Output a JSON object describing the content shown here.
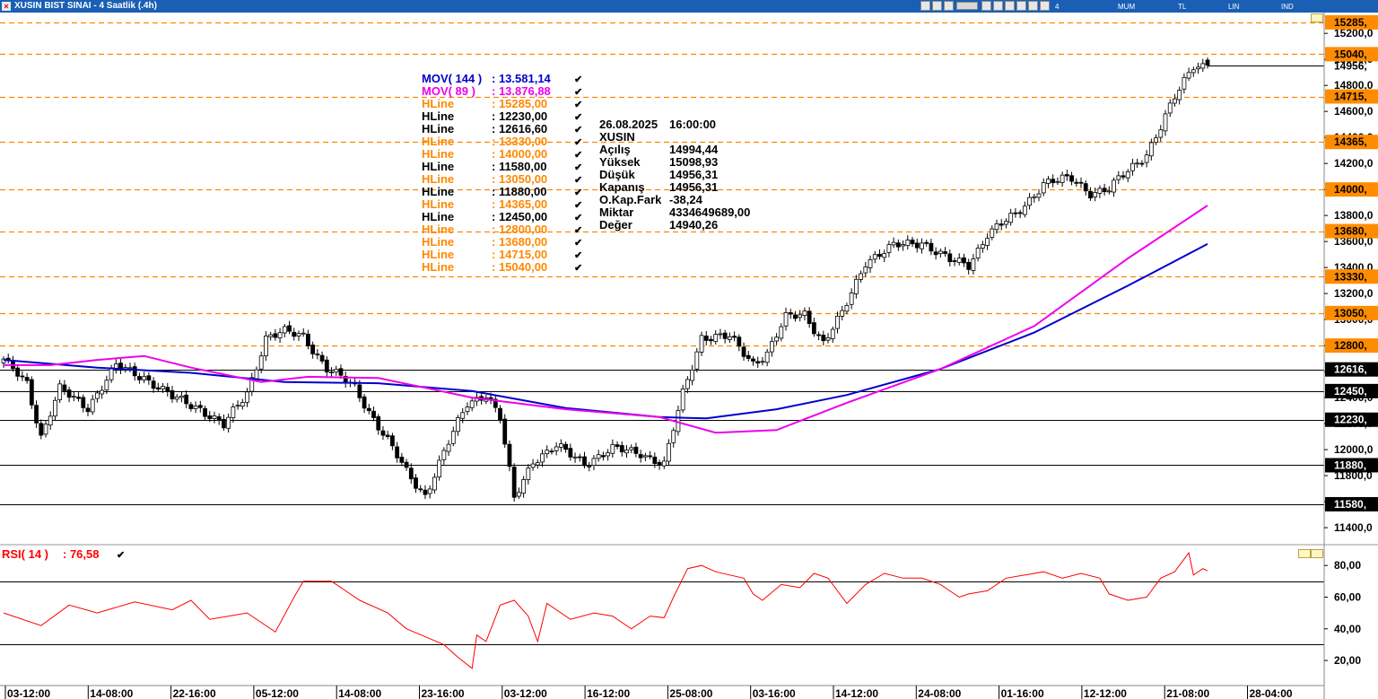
{
  "window": {
    "title": "XUSIN BIST SINAI - 4 Saatlik (.4h)",
    "toolbar_labels": [
      "4 Saatlik",
      "MUM",
      "TL",
      "LIN",
      "IND"
    ],
    "close_glyph": "×"
  },
  "colors": {
    "mov144": "#0000cc",
    "mov89": "#ee00ee",
    "hline_orange": "#ff8800",
    "hline_black": "#000000",
    "rsi": "#ff0000",
    "price_tag_bg": "#ff8c00"
  },
  "legend": [
    {
      "name": "MOV( 144 )",
      "value": ": 13.581,14",
      "color": "#0000cc"
    },
    {
      "name": "MOV( 89 )",
      "value": ": 13.876,88",
      "color": "#ee00ee"
    },
    {
      "name": "HLine",
      "value": ": 15285,00",
      "color": "#ff8800"
    },
    {
      "name": "HLine",
      "value": ": 12230,00",
      "color": "#000000"
    },
    {
      "name": "HLine",
      "value": ": 12616,60",
      "color": "#000000"
    },
    {
      "name": "HLine",
      "value": ": 13330,00",
      "color": "#ff8800"
    },
    {
      "name": "HLine",
      "value": ": 14000,00",
      "color": "#ff8800"
    },
    {
      "name": "HLine",
      "value": ": 11580,00",
      "color": "#000000"
    },
    {
      "name": "HLine",
      "value": ": 13050,00",
      "color": "#ff8800"
    },
    {
      "name": "HLine",
      "value": ": 11880,00",
      "color": "#000000"
    },
    {
      "name": "HLine",
      "value": ": 14365,00",
      "color": "#ff8800"
    },
    {
      "name": "HLine",
      "value": ": 12450,00",
      "color": "#000000"
    },
    {
      "name": "HLine",
      "value": ": 12800,00",
      "color": "#ff8800"
    },
    {
      "name": "HLine",
      "value": ": 13680,00",
      "color": "#ff8800"
    },
    {
      "name": "HLine",
      "value": ": 14715,00",
      "color": "#ff8800"
    },
    {
      "name": "HLine",
      "value": ": 15040,00",
      "color": "#ff8800"
    }
  ],
  "info_box": {
    "date": "26.08.2025",
    "time": "16:00:00",
    "symbol": "XUSIN",
    "rows": [
      {
        "label": "Açılış",
        "value": "14994,44"
      },
      {
        "label": "Yüksek",
        "value": "15098,93"
      },
      {
        "label": "Düşük",
        "value": "14956,31"
      },
      {
        "label": "Kapanış",
        "value": "14956,31"
      },
      {
        "label": "O.Kap.Fark",
        "value": "-38,24"
      },
      {
        "label": "Miktar",
        "value": "4334649689,00"
      },
      {
        "label": "Değer",
        "value": "14940,26"
      }
    ]
  },
  "rsi_label": {
    "name": "RSI( 14 )",
    "value": ": 76,58"
  },
  "check_glyph": "✔",
  "chart_data": [
    {
      "type": "candlestick",
      "title": "XUSIN BIST SINAI - 4 Saatlik (.4h)",
      "ylim": [
        11290,
        15360
      ],
      "y_ticks": [
        {
          "value": 11400,
          "label": "11400,0"
        },
        {
          "value": 11600,
          "label": "11600,0"
        },
        {
          "value": 11800,
          "label": "11800,0"
        },
        {
          "value": 12000,
          "label": "12000,0"
        },
        {
          "value": 12200,
          "label": "12200,0"
        },
        {
          "value": 12400,
          "label": "12400,0"
        },
        {
          "value": 12600,
          "label": "12600,0"
        },
        {
          "value": 12800,
          "label": "12800,0"
        },
        {
          "value": 13000,
          "label": "13000,0"
        },
        {
          "value": 13200,
          "label": "13200,0"
        },
        {
          "value": 13400,
          "label": "13400,0"
        },
        {
          "value": 13600,
          "label": "13600,0"
        },
        {
          "value": 13800,
          "label": "13800,0"
        },
        {
          "value": 14000,
          "label": "14000,0"
        },
        {
          "value": 14200,
          "label": "14200,0"
        },
        {
          "value": 14400,
          "label": "14400,0"
        },
        {
          "value": 14600,
          "label": "14600,0"
        },
        {
          "value": 14800,
          "label": "14800,0"
        },
        {
          "value": 15000,
          "label": "15000,0"
        },
        {
          "value": 15200,
          "label": "15200,0"
        }
      ],
      "x_tick_labels": [
        "03-12:00",
        "14-08:00",
        "22-16:00",
        "05-12:00",
        "14-08:00",
        "23-16:00",
        "03-12:00",
        "16-12:00",
        "25-08:00",
        "03-16:00",
        "14-12:00",
        "24-08:00",
        "01-16:00",
        "12-12:00",
        "21-08:00",
        "28-04:00"
      ],
      "hlines": [
        {
          "value": 15285,
          "label": "15285,",
          "color": "#ff8800",
          "style": "dashed"
        },
        {
          "value": 15040,
          "label": "15040,",
          "color": "#ff8800",
          "style": "dashed"
        },
        {
          "value": 14715,
          "label": "14715,",
          "color": "#ff8800",
          "style": "dashed"
        },
        {
          "value": 14365,
          "label": "14365,",
          "color": "#ff8800",
          "style": "dashed"
        },
        {
          "value": 14000,
          "label": "14000,",
          "color": "#ff8800",
          "style": "dashed"
        },
        {
          "value": 13680,
          "label": "13680,",
          "color": "#ff8800",
          "style": "dashed"
        },
        {
          "value": 13330,
          "label": "13330,",
          "color": "#ff8800",
          "style": "dashed"
        },
        {
          "value": 13050,
          "label": "13050,",
          "color": "#ff8800",
          "style": "dashed"
        },
        {
          "value": 12800,
          "label": "12800,",
          "color": "#ff8800",
          "style": "dashed"
        },
        {
          "value": 12616.6,
          "label": "12616,",
          "color": "#000000",
          "style": "solid"
        },
        {
          "value": 12450,
          "label": "12450,",
          "color": "#000000",
          "style": "solid"
        },
        {
          "value": 12230,
          "label": "12230,",
          "color": "#000000",
          "style": "solid"
        },
        {
          "value": 11880,
          "label": "11880,",
          "color": "#000000",
          "style": "solid"
        },
        {
          "value": 11580,
          "label": "11580,",
          "color": "#000000",
          "style": "solid"
        }
      ],
      "last_price": {
        "value": 14956.31,
        "label": "14956,"
      },
      "close_anchors": [
        {
          "i": 0,
          "close": 12680
        },
        {
          "i": 5,
          "close": 12520
        },
        {
          "i": 8,
          "close": 12100
        },
        {
          "i": 12,
          "close": 12460
        },
        {
          "i": 18,
          "close": 12330
        },
        {
          "i": 24,
          "close": 12640
        },
        {
          "i": 30,
          "close": 12560
        },
        {
          "i": 36,
          "close": 12400
        },
        {
          "i": 42,
          "close": 12320
        },
        {
          "i": 47,
          "close": 12180
        },
        {
          "i": 52,
          "close": 12440
        },
        {
          "i": 56,
          "close": 12860
        },
        {
          "i": 60,
          "close": 12900
        },
        {
          "i": 64,
          "close": 12880
        },
        {
          "i": 69,
          "close": 12620
        },
        {
          "i": 75,
          "close": 12480
        },
        {
          "i": 80,
          "close": 12180
        },
        {
          "i": 86,
          "close": 11830
        },
        {
          "i": 90,
          "close": 11650
        },
        {
          "i": 95,
          "close": 12050
        },
        {
          "i": 99,
          "close": 12360
        },
        {
          "i": 103,
          "close": 12430
        },
        {
          "i": 106,
          "close": 12240
        },
        {
          "i": 109,
          "close": 11620
        },
        {
          "i": 113,
          "close": 11920
        },
        {
          "i": 118,
          "close": 12020
        },
        {
          "i": 124,
          "close": 11900
        },
        {
          "i": 130,
          "close": 12000
        },
        {
          "i": 136,
          "close": 11980
        },
        {
          "i": 141,
          "close": 11880
        },
        {
          "i": 145,
          "close": 12430
        },
        {
          "i": 149,
          "close": 12870
        },
        {
          "i": 155,
          "close": 12860
        },
        {
          "i": 160,
          "close": 12670
        },
        {
          "i": 163,
          "close": 12740
        },
        {
          "i": 167,
          "close": 13010
        },
        {
          "i": 171,
          "close": 13050
        },
        {
          "i": 175,
          "close": 12820
        },
        {
          "i": 179,
          "close": 13040
        },
        {
          "i": 184,
          "close": 13450
        },
        {
          "i": 190,
          "close": 13560
        },
        {
          "i": 196,
          "close": 13600
        },
        {
          "i": 202,
          "close": 13450
        },
        {
          "i": 206,
          "close": 13420
        },
        {
          "i": 210,
          "close": 13660
        },
        {
          "i": 216,
          "close": 13800
        },
        {
          "i": 222,
          "close": 14050
        },
        {
          "i": 228,
          "close": 14080
        },
        {
          "i": 232,
          "close": 13980
        },
        {
          "i": 236,
          "close": 14000
        },
        {
          "i": 240,
          "close": 14140
        },
        {
          "i": 244,
          "close": 14280
        },
        {
          "i": 247,
          "close": 14480
        },
        {
          "i": 250,
          "close": 14700
        },
        {
          "i": 254,
          "close": 14960
        },
        {
          "i": 257,
          "close": 14956
        }
      ],
      "series": [
        {
          "name": "MOV( 144 )",
          "color": "#0000cc",
          "last_value": 13581.14,
          "points": [
            [
              0,
              12690
            ],
            [
              20,
              12630
            ],
            [
              40,
              12590
            ],
            [
              60,
              12520
            ],
            [
              80,
              12510
            ],
            [
              100,
              12450
            ],
            [
              120,
              12320
            ],
            [
              140,
              12250
            ],
            [
              150,
              12240
            ],
            [
              165,
              12310
            ],
            [
              180,
              12420
            ],
            [
              200,
              12620
            ],
            [
              220,
              12900
            ],
            [
              240,
              13260
            ],
            [
              257,
              13581.14
            ]
          ]
        },
        {
          "name": "MOV( 89 )",
          "color": "#ee00ee",
          "last_value": 13876.88,
          "points": [
            [
              0,
              12650
            ],
            [
              10,
              12650
            ],
            [
              20,
              12690
            ],
            [
              30,
              12720
            ],
            [
              40,
              12630
            ],
            [
              55,
              12520
            ],
            [
              65,
              12560
            ],
            [
              80,
              12550
            ],
            [
              100,
              12400
            ],
            [
              120,
              12310
            ],
            [
              140,
              12250
            ],
            [
              152,
              12130
            ],
            [
              165,
              12150
            ],
            [
              180,
              12360
            ],
            [
              200,
              12620
            ],
            [
              220,
              12950
            ],
            [
              240,
              13470
            ],
            [
              257,
              13876.88
            ]
          ]
        }
      ]
    },
    {
      "type": "line",
      "name": "RSI( 14 )",
      "last_value": 76.58,
      "ylim": [
        7,
        92
      ],
      "y_ticks": [
        {
          "value": 20,
          "label": "20,00"
        },
        {
          "value": 40,
          "label": "40,00"
        },
        {
          "value": 60,
          "label": "60,00"
        },
        {
          "value": 80,
          "label": "80,00"
        }
      ],
      "reference_lines": [
        70,
        30
      ],
      "points": [
        [
          0,
          50
        ],
        [
          8,
          42
        ],
        [
          14,
          55
        ],
        [
          20,
          50
        ],
        [
          28,
          57
        ],
        [
          36,
          52
        ],
        [
          40,
          58
        ],
        [
          44,
          46
        ],
        [
          52,
          50
        ],
        [
          58,
          38
        ],
        [
          62,
          60
        ],
        [
          64,
          70
        ],
        [
          70,
          70
        ],
        [
          76,
          58
        ],
        [
          82,
          50
        ],
        [
          86,
          40
        ],
        [
          90,
          35
        ],
        [
          94,
          30
        ],
        [
          97,
          22
        ],
        [
          100,
          15
        ],
        [
          101,
          36
        ],
        [
          103,
          32
        ],
        [
          106,
          55
        ],
        [
          109,
          58
        ],
        [
          112,
          48
        ],
        [
          114,
          32
        ],
        [
          116,
          56
        ],
        [
          121,
          46
        ],
        [
          126,
          50
        ],
        [
          130,
          48
        ],
        [
          134,
          40
        ],
        [
          138,
          48
        ],
        [
          141,
          47
        ],
        [
          143,
          60
        ],
        [
          146,
          78
        ],
        [
          149,
          80
        ],
        [
          152,
          76
        ],
        [
          155,
          74
        ],
        [
          158,
          72
        ],
        [
          160,
          62
        ],
        [
          162,
          58
        ],
        [
          166,
          68
        ],
        [
          170,
          66
        ],
        [
          173,
          75
        ],
        [
          176,
          72
        ],
        [
          180,
          56
        ],
        [
          184,
          68
        ],
        [
          188,
          75
        ],
        [
          192,
          72
        ],
        [
          196,
          72
        ],
        [
          200,
          68
        ],
        [
          204,
          60
        ],
        [
          206,
          62
        ],
        [
          210,
          64
        ],
        [
          214,
          72
        ],
        [
          218,
          74
        ],
        [
          222,
          76
        ],
        [
          226,
          72
        ],
        [
          230,
          75
        ],
        [
          234,
          72
        ],
        [
          236,
          62
        ],
        [
          240,
          58
        ],
        [
          244,
          60
        ],
        [
          247,
          72
        ],
        [
          250,
          76
        ],
        [
          253,
          88
        ],
        [
          254,
          74
        ],
        [
          256,
          78
        ],
        [
          257,
          76.58
        ]
      ]
    }
  ]
}
